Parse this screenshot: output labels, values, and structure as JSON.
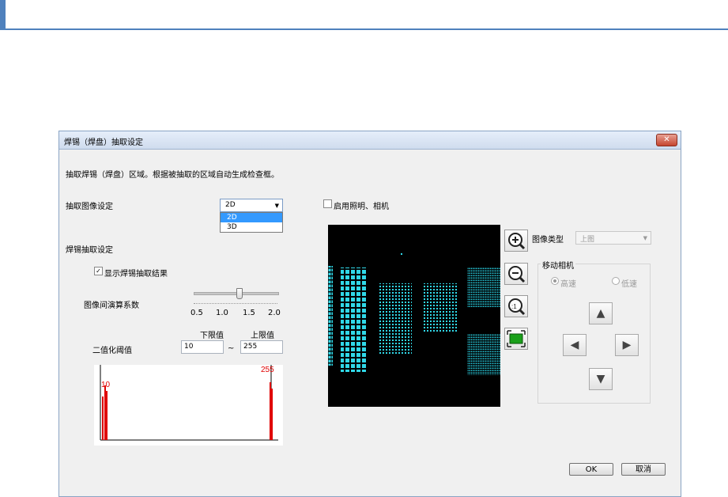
{
  "dialog": {
    "title": "焊锡（焊盘）抽取设定",
    "description": "抽取焊锡（焊盘）区域。根据被抽取的区域自动生成检查框。",
    "close_symbol": "✕"
  },
  "extract_image": {
    "label": "抽取图像设定",
    "selected": "2D",
    "options": [
      "2D",
      "3D"
    ]
  },
  "lighting_camera": {
    "label": "启用照明、相机",
    "checked": false
  },
  "solder_section": {
    "label": "焊锡抽取设定",
    "show_result_label": "显示焊锡抽取结果",
    "show_result_checked": true,
    "coefficient_label": "图像间演算系数",
    "slider_ticks": [
      "0.5",
      "1.0",
      "1.5",
      "2.0"
    ],
    "slider_value": 1.3,
    "binarize_label": "二值化阈值",
    "lower_label": "下限值",
    "upper_label": "上限值",
    "range_sep": "~",
    "lower_value": "10",
    "upper_value": "255"
  },
  "histogram": {
    "left_label": "10",
    "right_label": "255",
    "color": "#ff0000"
  },
  "image_type": {
    "label": "图像类型",
    "value": "上图"
  },
  "camera_move": {
    "label": "移动相机",
    "high_speed": "高速",
    "low_speed": "低速",
    "up": "▲",
    "down": "▼",
    "left": "◀",
    "right": "▶"
  },
  "buttons": {
    "ok": "OK",
    "cancel": "取消"
  },
  "colors": {
    "accent": "#4f81bd",
    "pad_cyan": "#30d8e8"
  }
}
